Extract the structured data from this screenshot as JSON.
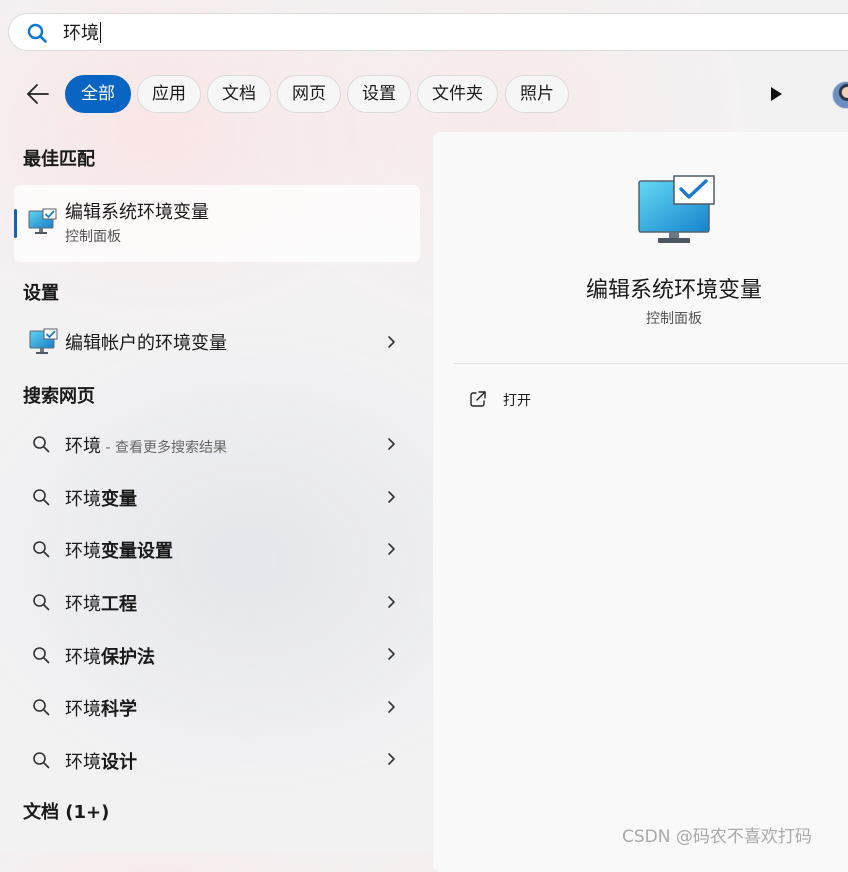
{
  "search": {
    "query": "环境"
  },
  "filters": [
    {
      "label": "全部",
      "active": true
    },
    {
      "label": "应用"
    },
    {
      "label": "文档"
    },
    {
      "label": "网页"
    },
    {
      "label": "设置"
    },
    {
      "label": "文件夹"
    },
    {
      "label": "照片"
    }
  ],
  "best_match": {
    "heading": "最佳匹配",
    "title": "编辑系统环境变量",
    "subtitle": "控制面板"
  },
  "settings": {
    "heading": "设置",
    "items": [
      {
        "label": "编辑帐户的环境变量"
      }
    ]
  },
  "web_search": {
    "heading": "搜索网页",
    "items": [
      {
        "prefix": "环境",
        "bold": "",
        "hint": " - 查看更多搜索结果"
      },
      {
        "prefix": "环境",
        "bold": "变量",
        "hint": ""
      },
      {
        "prefix": "环境",
        "bold": "变量设置",
        "hint": ""
      },
      {
        "prefix": "环境",
        "bold": "工程",
        "hint": ""
      },
      {
        "prefix": "环境",
        "bold": "保护法",
        "hint": ""
      },
      {
        "prefix": "环境",
        "bold": "科学",
        "hint": ""
      },
      {
        "prefix": "环境",
        "bold": "设计",
        "hint": ""
      }
    ]
  },
  "documents": {
    "heading": "文档 (1+)"
  },
  "preview": {
    "title": "编辑系统环境变量",
    "subtitle": "控制面板",
    "actions": [
      {
        "label": "打开",
        "icon": "open-external-icon"
      }
    ]
  },
  "watermark": "CSDN @码农不喜欢打码",
  "colors": {
    "accent": "#0a64c4"
  }
}
